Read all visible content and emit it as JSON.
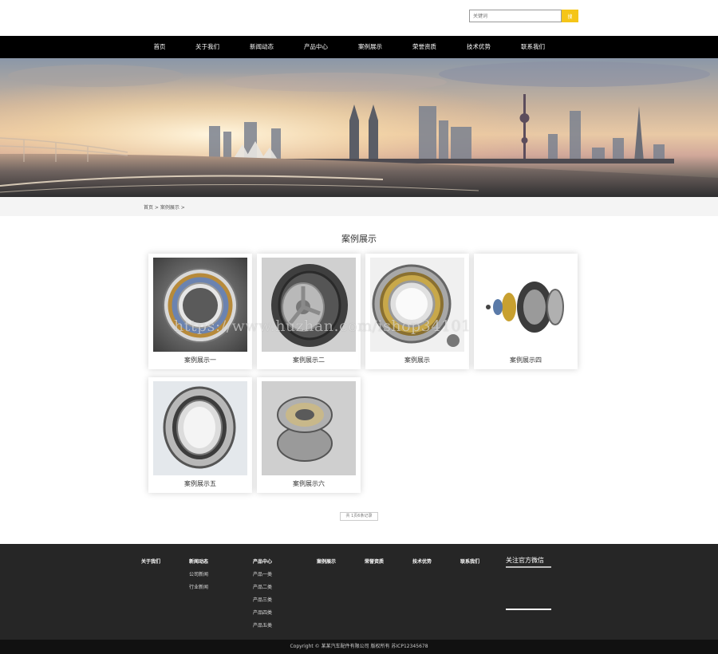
{
  "search": {
    "placeholder": "关键词",
    "button_label": "搜"
  },
  "nav": {
    "items": [
      {
        "label": "首页"
      },
      {
        "label": "关于我们"
      },
      {
        "label": "新闻动态"
      },
      {
        "label": "产品中心"
      },
      {
        "label": "案例展示"
      },
      {
        "label": "荣誉资质"
      },
      {
        "label": "技术优势"
      },
      {
        "label": "联系我们"
      }
    ]
  },
  "breadcrumb": {
    "text": "首页 > 案例展示 >"
  },
  "main": {
    "title": "案例展示",
    "cases": [
      {
        "caption": "案例展示一",
        "image": "bearing-blue-icon"
      },
      {
        "caption": "案例展示二",
        "image": "tire-icon"
      },
      {
        "caption": "案例展示",
        "image": "roller-bearing-icon"
      },
      {
        "caption": "案例展示四",
        "image": "wheel-assembly-icon"
      },
      {
        "caption": "案例展示五",
        "image": "ball-bearing-icon"
      },
      {
        "caption": "案例展示六",
        "image": "sealed-bearing-icon"
      }
    ],
    "pager": "共 1页6条记录"
  },
  "watermark": "https://www.huzhan.com/ishop34101",
  "footer": {
    "about": "关于我们",
    "news": {
      "head": "新闻动态",
      "links": [
        "公司新闻",
        "行业新闻"
      ]
    },
    "products": {
      "head": "产品中心",
      "links": [
        "产品一类",
        "产品二类",
        "产品三类",
        "产品四类",
        "产品五类"
      ]
    },
    "cases": "案例展示",
    "honor": "荣誉资质",
    "tech": "技术优势",
    "contact": "联系我们",
    "wechat": "关注官方微信",
    "copyright": "Copyright © 某某汽车配件有限公司 版权所有   苏ICP12345678"
  },
  "colors": {
    "accent": "#f5c518",
    "nav_bg": "#000000",
    "footer_bg": "#262626"
  }
}
